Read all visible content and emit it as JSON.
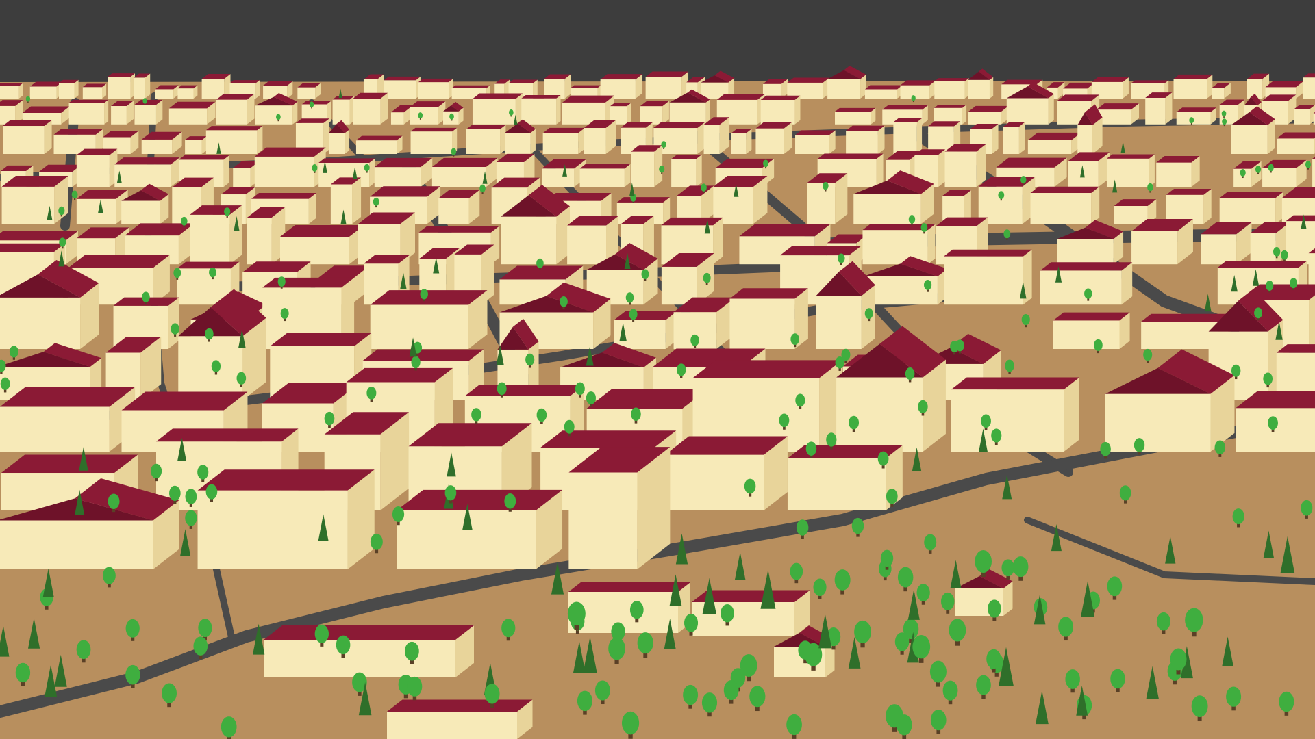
{
  "scene": {
    "type": "3d-city-model-viewport",
    "colors": {
      "sky": "#3d3d3d",
      "ground": "#b88f5e",
      "road": "#4a4a4a",
      "wall": "#f7eab8",
      "wall_shade": "#e8d49a",
      "roof": "#8b1a35",
      "roof_dark": "#6e1229",
      "tree_deciduous": "#3fae3f",
      "tree_conifer": "#2f6f2a",
      "trunk": "#5a4026"
    },
    "object_types": [
      "building",
      "pitched-roof-house",
      "road",
      "deciduous-tree",
      "conifer-tree"
    ]
  }
}
